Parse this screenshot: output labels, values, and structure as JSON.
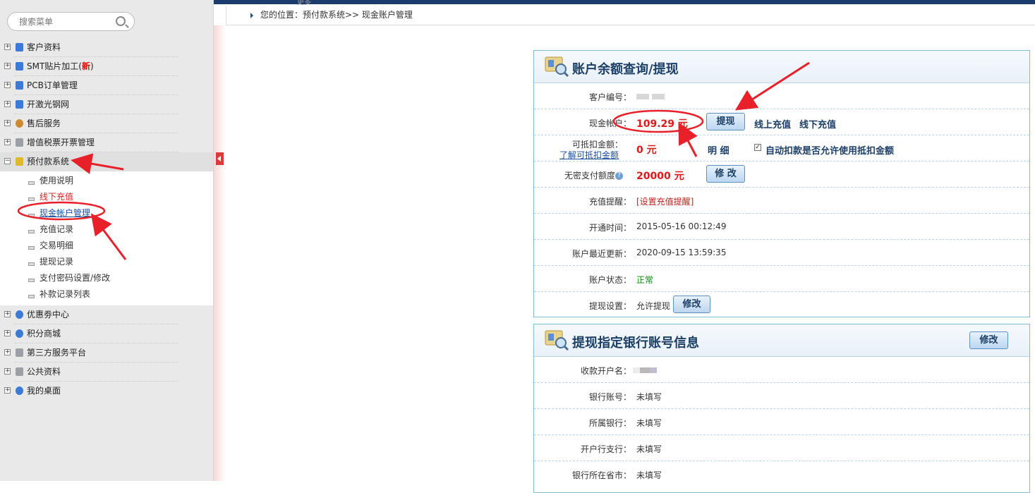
{
  "top_strip_text": "更多",
  "search": {
    "placeholder": "搜索菜单"
  },
  "menu": [
    {
      "label": "客户资料",
      "icon": "user-icon",
      "color": "#3a7bd5"
    },
    {
      "label": "SMT贴片加工(",
      "badge": "新",
      "suffix": ")",
      "icon": "chip-icon",
      "color": "#3a7bd5"
    },
    {
      "label": "PCB订单管理",
      "icon": "board-icon",
      "color": "#3a7bd5"
    },
    {
      "label": "开激光钢网",
      "icon": "stencil-icon",
      "color": "#3a7bd5"
    },
    {
      "label": "售后服务",
      "icon": "service-icon",
      "color": "#d08a2e"
    },
    {
      "label": "增值税票开票管理",
      "icon": "invoice-icon",
      "color": "#9aa0a6"
    },
    {
      "label": "预付款系统",
      "icon": "wallet-icon",
      "color": "#e0b82e"
    }
  ],
  "submenu": [
    {
      "label": "使用说明"
    },
    {
      "label": "线下充值"
    },
    {
      "label": "现金帐户管理"
    },
    {
      "label": "充值记录"
    },
    {
      "label": "交易明细"
    },
    {
      "label": "提现记录"
    },
    {
      "label": "支付密码设置/修改"
    },
    {
      "label": "补款记录列表"
    }
  ],
  "menu2": [
    {
      "label": "优惠劵中心",
      "icon": "coupon-icon",
      "color": "#3a7bd5"
    },
    {
      "label": "积分商城",
      "icon": "points-icon",
      "color": "#3a7bd5"
    },
    {
      "label": "第三方服务平台",
      "icon": "platform-icon",
      "color": "#9aa0a6"
    },
    {
      "label": "公共资料",
      "icon": "docs-icon",
      "color": "#9aa0a6"
    },
    {
      "label": "我的桌面",
      "icon": "desktop-icon",
      "color": "#3a7bd5"
    }
  ],
  "breadcrumb": {
    "text": "您的位置：预付款系统>> 现金账户管理"
  },
  "panel1": {
    "title": "账户余额查询/提现",
    "customer_label": "客户编号",
    "cash_label": "现金帐户",
    "cash_value": "109.29 元",
    "withdraw_btn": "提现",
    "online_recharge": "线上充值",
    "offline_recharge": "线下充值",
    "deduct_label": "可抵扣金额：",
    "deduct_link": "了解可抵扣金额",
    "deduct_value": "0 元",
    "detail_link": "明 细",
    "auto_deduct_text": "自动扣款是否允许使用抵扣金额",
    "nopwd_label": "无密支付额度",
    "nopwd_value": "20000 元",
    "modify_btn": "修 改",
    "remind_label": "充值提醒",
    "remind_value": "[设置充值提醒]",
    "open_label": "开通时间",
    "open_value": "2015-05-16 00:12:49",
    "update_label": "账户最近更新",
    "update_value": "2020-09-15 13:59:35",
    "status_label": "账户状态",
    "status_value": "正常",
    "withdraw_setting_label": "提现设置",
    "withdraw_setting_value": "允许提现",
    "withdraw_setting_btn": "修改"
  },
  "panel2": {
    "title": "提现指定银行账号信息",
    "modify_btn": "修改",
    "rows": [
      {
        "label": "收款开户名",
        "value": ""
      },
      {
        "label": "银行账号",
        "value": "未填写"
      },
      {
        "label": "所属银行",
        "value": "未填写"
      },
      {
        "label": "开户行支行",
        "value": "未填写"
      },
      {
        "label": "银行所在省市",
        "value": "未填写"
      }
    ]
  },
  "colors": {
    "accent": "#1b3f66",
    "money": "#e01919",
    "annotation": "#e8202a",
    "border": "#7fbcd8"
  }
}
